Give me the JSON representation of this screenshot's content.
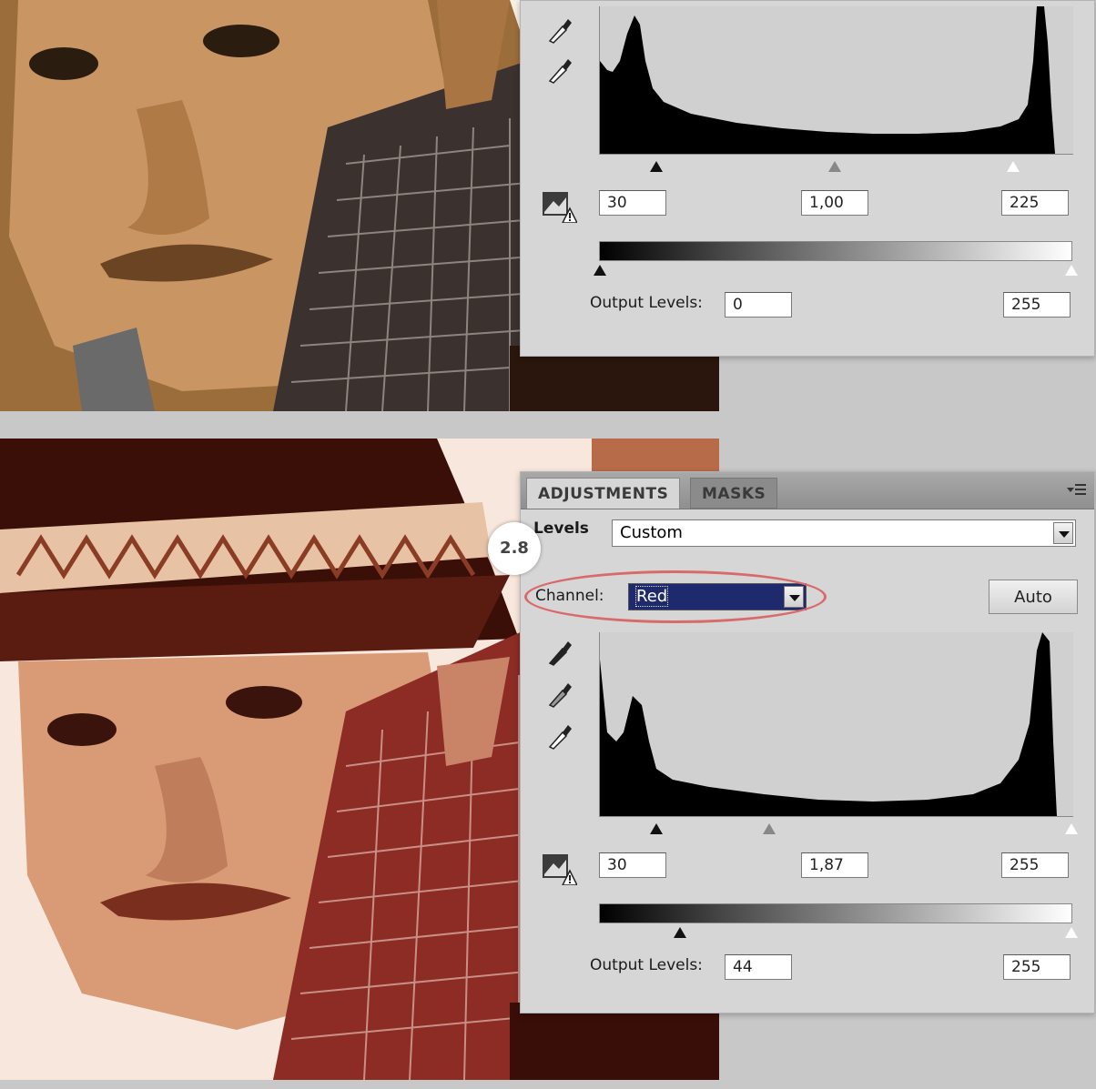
{
  "top_panel": {
    "input_black": "30",
    "input_gamma": "1,00",
    "input_white": "225",
    "output_label": "Output Levels:",
    "output_black": "0",
    "output_white": "255"
  },
  "bottom_panel": {
    "tabs": [
      "ADJUSTMENTS",
      "MASKS"
    ],
    "levels_label": "Levels",
    "preset_value": "Custom",
    "step_badge": "2.8",
    "channel_label": "Channel:",
    "channel_value": "Red",
    "auto_button": "Auto",
    "input_black": "30",
    "input_gamma": "1,87",
    "input_white": "255",
    "output_label": "Output Levels:",
    "output_black": "44",
    "output_white": "255"
  },
  "colors": {
    "highlight_oval": "#d96a6a",
    "channel_selection": "#1f2a6e"
  },
  "icons": {
    "eyedroppers": [
      "black-point-eyedropper-icon",
      "gray-point-eyedropper-icon",
      "white-point-eyedropper-icon"
    ],
    "clipping_warning": "clipping-warning-icon",
    "panel_menu": "panel-menu-icon"
  }
}
